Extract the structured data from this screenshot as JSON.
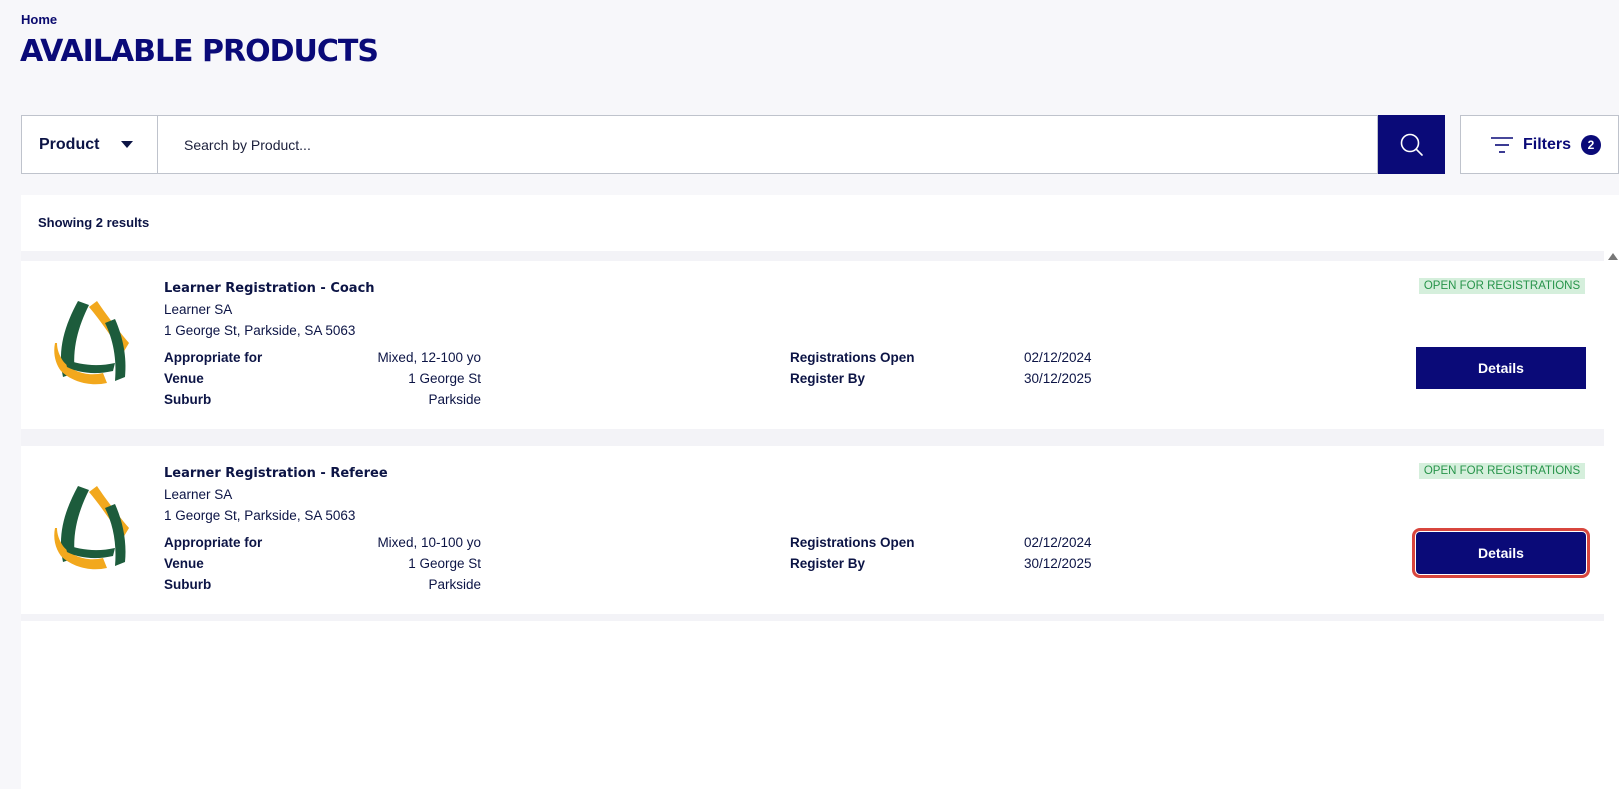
{
  "breadcrumb": "Home",
  "page_title": "AVAILABLE PRODUCTS",
  "search": {
    "category": "Product",
    "placeholder": "Search by Product...",
    "value": ""
  },
  "filters": {
    "label": "Filters",
    "count": "2"
  },
  "results_label": "Showing 2 results",
  "cards": [
    {
      "title": "Learner Registration - Coach",
      "org": "Learner SA",
      "address": "1 George St, Parkside, SA 5063",
      "appropriate_label": "Appropriate for",
      "appropriate_value": "Mixed, 12-100 yo",
      "venue_label": "Venue",
      "venue_value": "1 George St",
      "suburb_label": "Suburb",
      "suburb_value": "Parkside",
      "reg_open_label": "Registrations Open",
      "reg_open_value": "02/12/2024",
      "register_by_label": "Register By",
      "register_by_value": "30/12/2025",
      "status": "OPEN FOR REGISTRATIONS",
      "details_label": "Details"
    },
    {
      "title": "Learner Registration - Referee",
      "org": "Learner SA",
      "address": "1 George St, Parkside, SA 5063",
      "appropriate_label": "Appropriate for",
      "appropriate_value": "Mixed, 10-100 yo",
      "venue_label": "Venue",
      "venue_value": "1 George St",
      "suburb_label": "Suburb",
      "suburb_value": "Parkside",
      "reg_open_label": "Registrations Open",
      "reg_open_value": "02/12/2024",
      "register_by_label": "Register By",
      "register_by_value": "30/12/2025",
      "status": "OPEN FOR REGISTRATIONS",
      "details_label": "Details"
    }
  ],
  "colors": {
    "brand_navy": "#0a0a78",
    "status_green": "#27944a",
    "status_green_bg": "#d5efdc",
    "logo_green": "#1d5c3c",
    "logo_gold": "#f2a81d",
    "focus_ring": "#d8463e"
  }
}
